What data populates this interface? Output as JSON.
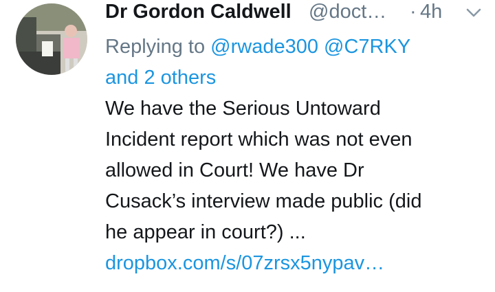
{
  "tweet": {
    "author_name": "Dr Gordon Caldwell",
    "handle": "@doct…",
    "separator": "·",
    "timestamp": "4h",
    "menu_icon": "chevron-down-icon",
    "reply_prefix": "Replying to",
    "mention_1": "@rwade300",
    "mention_2": "@C7RKY",
    "others": "and 2 others",
    "text_line_1": "We have the Serious Untoward",
    "text_line_2": "Incident report which was not even",
    "text_line_3": "allowed in Court! We have Dr",
    "text_line_4": "Cusack’s interview made public (did",
    "text_line_5": "he appear in court?) ...",
    "link_text": "dropbox.com/s/07zrsx5nypav…"
  },
  "colors": {
    "text": "#14171a",
    "secondary": "#657786",
    "link": "#1b95e0"
  }
}
